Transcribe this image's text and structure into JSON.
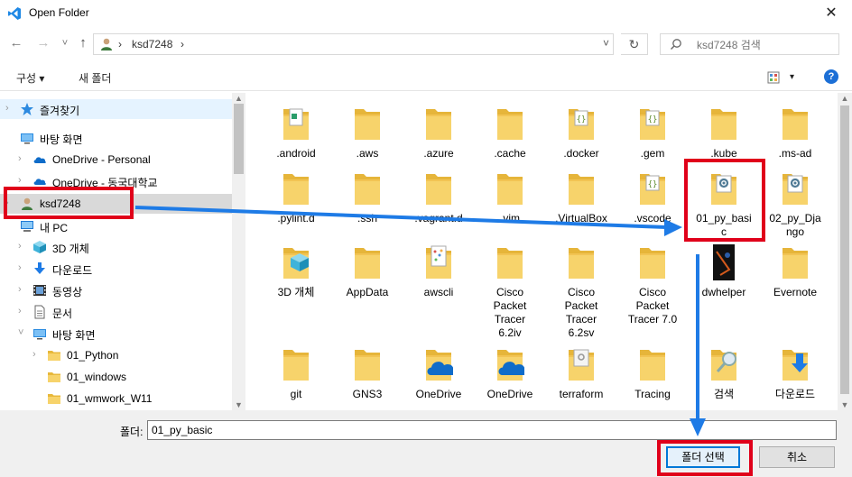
{
  "window": {
    "title": "Open Folder",
    "close": "✕"
  },
  "address": {
    "back": "←",
    "forward": "→",
    "recent": "˅",
    "up": "↑",
    "sep1": "›",
    "path": "ksd7248",
    "sep2": "›",
    "dropdown": "˅",
    "refresh": "↻",
    "search_placeholder": "ksd7248 검색"
  },
  "toolbar": {
    "organize": "구성 ▾",
    "new_folder": "새 폴더",
    "view_arrow": "▾",
    "help": "?"
  },
  "nav": [
    {
      "label": "즐겨찾기",
      "icon": "star-icon",
      "chev": "›",
      "state": "sel"
    },
    {
      "label": "바탕 화면",
      "icon": "desktop-icon",
      "chev": "",
      "state": ""
    },
    {
      "label": "OneDrive - Personal",
      "icon": "cloud-icon",
      "chev": "›",
      "state": ""
    },
    {
      "label": "OneDrive - 동국대학교",
      "icon": "cloud-icon",
      "chev": "›",
      "state": ""
    },
    {
      "label": "ksd7248",
      "icon": "user-icon",
      "chev": "›",
      "state": "hl"
    },
    {
      "label": "내 PC",
      "icon": "pc-icon",
      "chev": "",
      "state": ""
    },
    {
      "label": "3D 개체",
      "icon": "cube-icon",
      "chev": "›",
      "state": ""
    },
    {
      "label": "다운로드",
      "icon": "download-icon",
      "chev": "›",
      "state": ""
    },
    {
      "label": "동영상",
      "icon": "video-icon",
      "chev": "›",
      "state": ""
    },
    {
      "label": "문서",
      "icon": "document-icon",
      "chev": "›",
      "state": ""
    },
    {
      "label": "바탕 화면",
      "icon": "desktop-icon",
      "chev": "˅",
      "state": ""
    },
    {
      "label": "01_Python",
      "icon": "folder-icon",
      "chev": "›",
      "state": ""
    },
    {
      "label": "01_windows",
      "icon": "folder-icon",
      "chev": "",
      "state": ""
    },
    {
      "label": "01_wmwork_W11",
      "icon": "folder-icon",
      "chev": "",
      "state": ""
    }
  ],
  "files": [
    [
      ".android",
      ".aws",
      ".azure",
      ".cache",
      ".docker",
      ".gem",
      ".kube",
      ".ms-ad"
    ],
    [
      ".pylint.d",
      ".ssh",
      ".vagrant.d",
      ".vim",
      ".VirtualBox",
      ".vscode",
      "01_py_basic",
      "02_py_Django"
    ],
    [
      "3D 개체",
      "AppData",
      "awscli",
      "Cisco Packet Tracer 6.2iv",
      "Cisco Packet Tracer 6.2sv",
      "Cisco Packet Tracer 7.0",
      "dwhelper",
      "Evernote"
    ],
    [
      "git",
      "GNS3",
      "OneDrive",
      "OneDrive",
      "terraform",
      "Tracing",
      "검색",
      "다운로드"
    ]
  ],
  "file_labels_display": {
    "01_py_basic": [
      "01_py_basi",
      "c"
    ],
    "02_py_Django": [
      "02_py_Dja",
      "ngo"
    ],
    "Cisco Packet Tracer 6.2iv": [
      "Cisco",
      "Packet",
      "Tracer",
      "6.2iv"
    ],
    "Cisco Packet Tracer 6.2sv": [
      "Cisco",
      "Packet",
      "Tracer",
      "6.2sv"
    ],
    "Cisco Packet Tracer 7.0": [
      "Cisco",
      "Packet",
      "Tracer 7.0"
    ]
  },
  "bottom": {
    "folder_label": "폴더:",
    "folder_value": "01_py_basic",
    "select": "폴더 선택",
    "cancel": "취소"
  },
  "colors": {
    "annotation_red": "#e0001a",
    "annotation_blue": "#1e7be6",
    "folder": "#f3c94c"
  }
}
